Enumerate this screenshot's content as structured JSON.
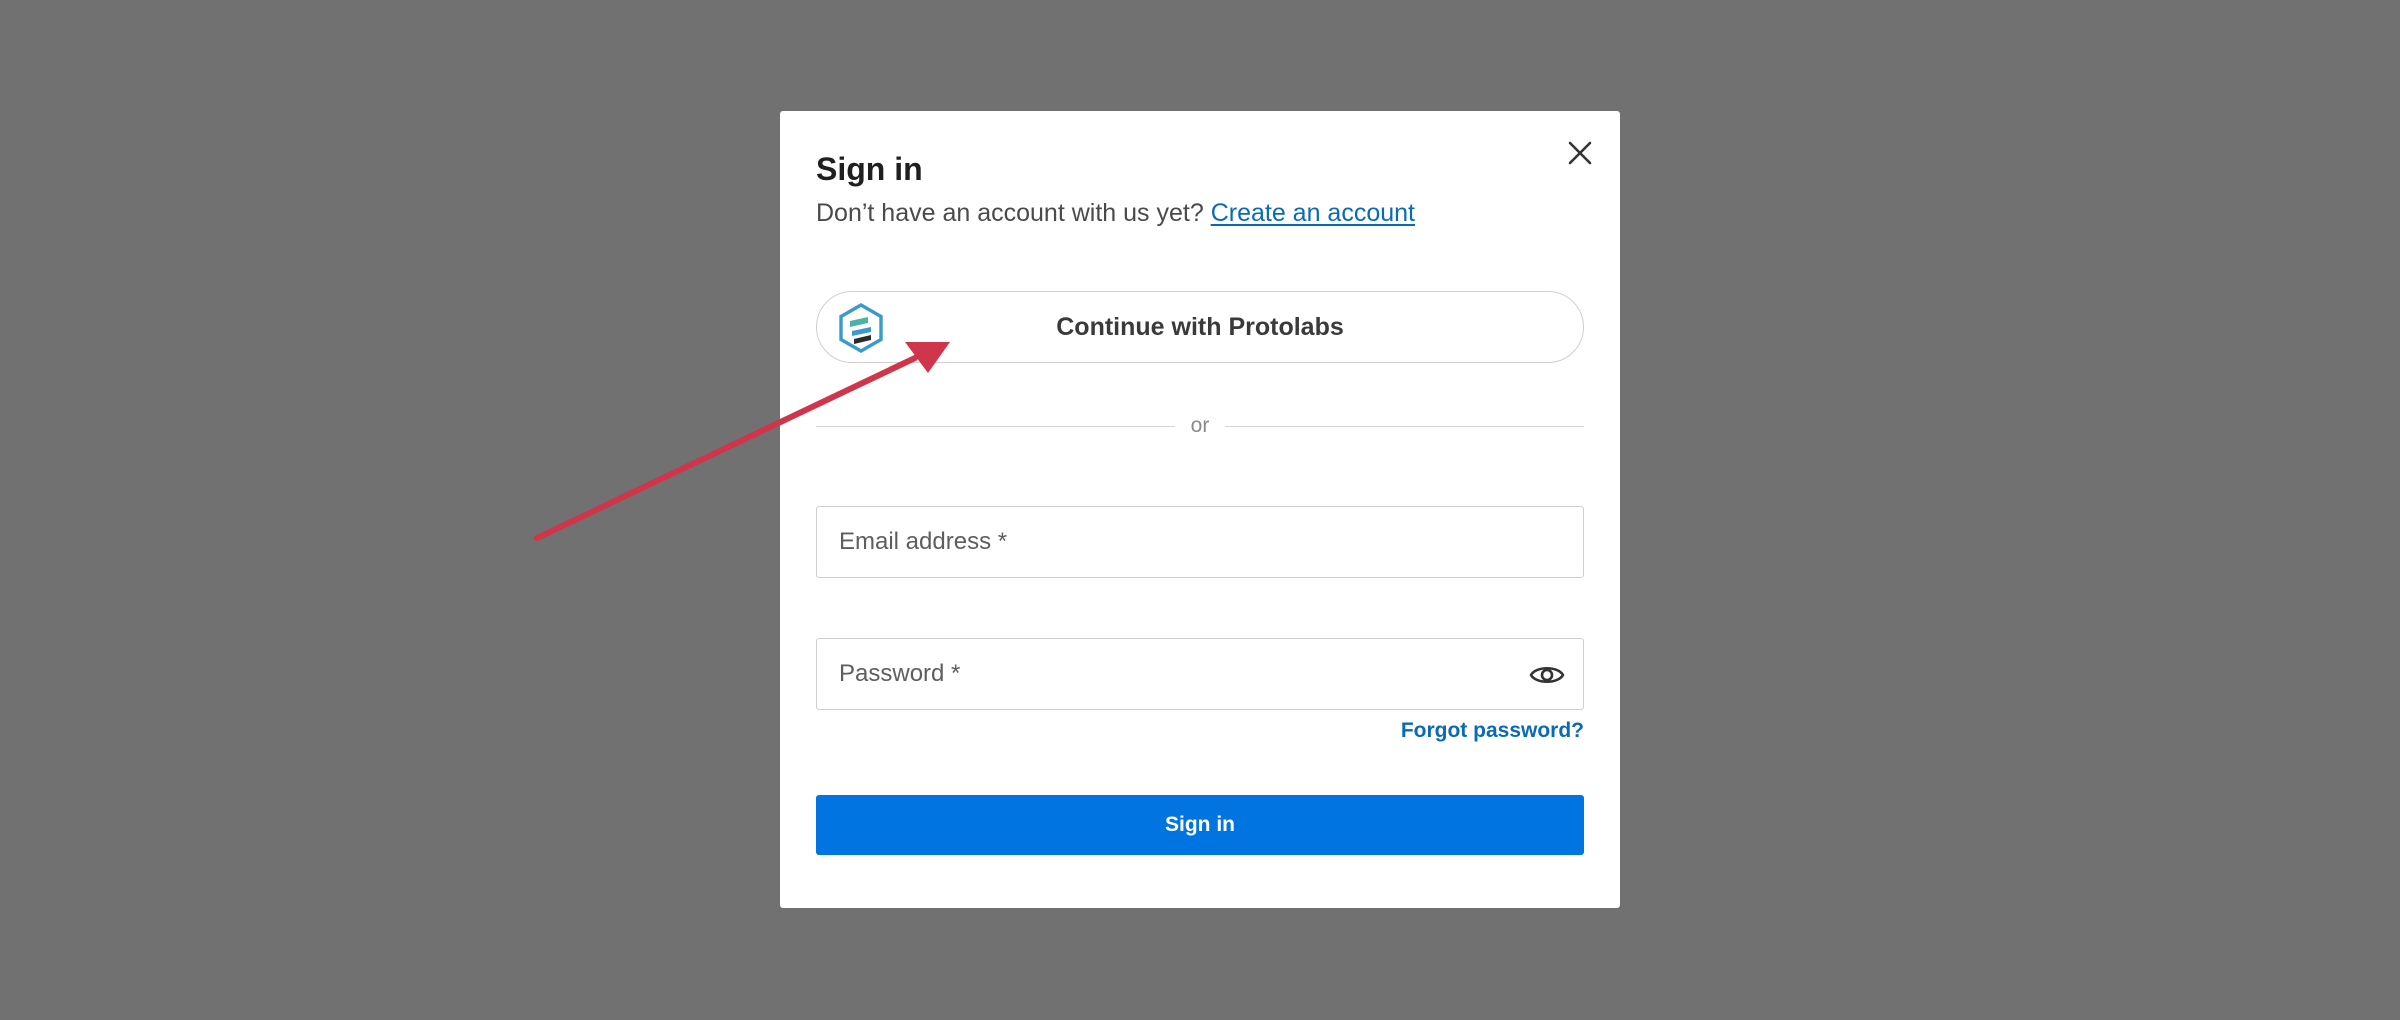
{
  "modal": {
    "title": "Sign in",
    "subtitle_text": "Don’t have an account with us yet?",
    "create_account_link": "Create an account",
    "close_icon": "close-icon"
  },
  "sso": {
    "label": "Continue with Protolabs",
    "icon": "protolabs-logo-icon"
  },
  "divider": {
    "label": "or"
  },
  "form": {
    "email_placeholder": "Email address *",
    "email_value": "",
    "password_placeholder": "Password *",
    "password_value": "",
    "password_toggle_icon": "eye-icon",
    "forgot_password": "Forgot password?",
    "submit_label": "Sign in"
  },
  "annotation": {
    "type": "arrow",
    "color": "#d0364b"
  },
  "colors": {
    "backdrop": "#717171",
    "link": "#0a6ab8",
    "primary_button": "#0074e0"
  }
}
